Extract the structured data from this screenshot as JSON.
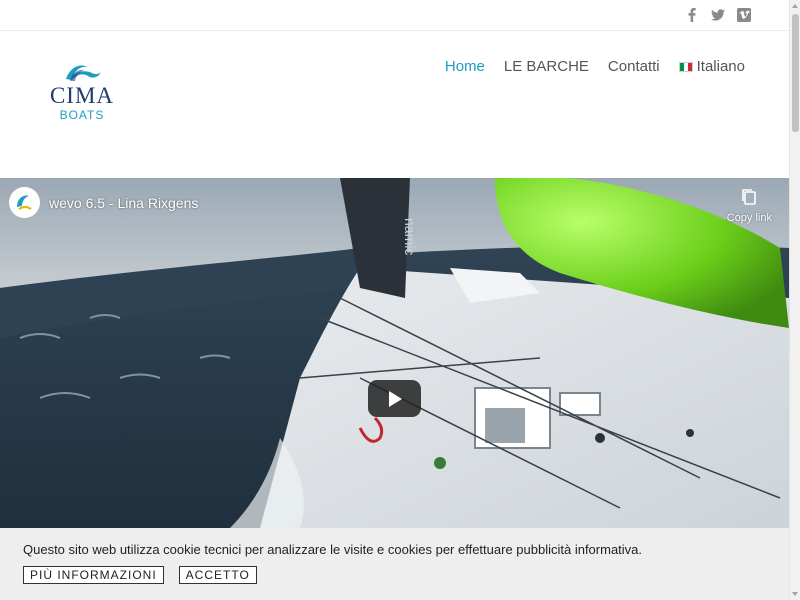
{
  "social": {
    "items": [
      {
        "name": "facebook",
        "icon": "facebook-icon"
      },
      {
        "name": "twitter",
        "icon": "twitter-icon"
      },
      {
        "name": "vimeo",
        "icon": "vimeo-icon"
      }
    ]
  },
  "logo": {
    "name": "CIMA",
    "sub": "BOATS",
    "colors": {
      "primary": "#1e3a6d",
      "accent": "#1e9dc4"
    }
  },
  "nav": {
    "items": [
      {
        "label": "Home",
        "active": true
      },
      {
        "label": "LE BARCHE",
        "active": false
      },
      {
        "label": "Contatti",
        "active": false
      },
      {
        "label": "Italiano",
        "active": false,
        "icon": "italy-flag-icon"
      }
    ],
    "active_color": "#1e9dc4"
  },
  "video": {
    "title": "wevo 6.5 - Lina Rixgens",
    "copy_label": "Copy link",
    "copy_icon": "copy-icon",
    "play_icon": "play-icon"
  },
  "cookie": {
    "message": "Questo sito web utilizza cookie tecnici per analizzare le visite e cookies per effettuare pubblicità informativa.",
    "more_label": "PIÙ INFORMAZIONI",
    "accept_label": "ACCETTO"
  }
}
